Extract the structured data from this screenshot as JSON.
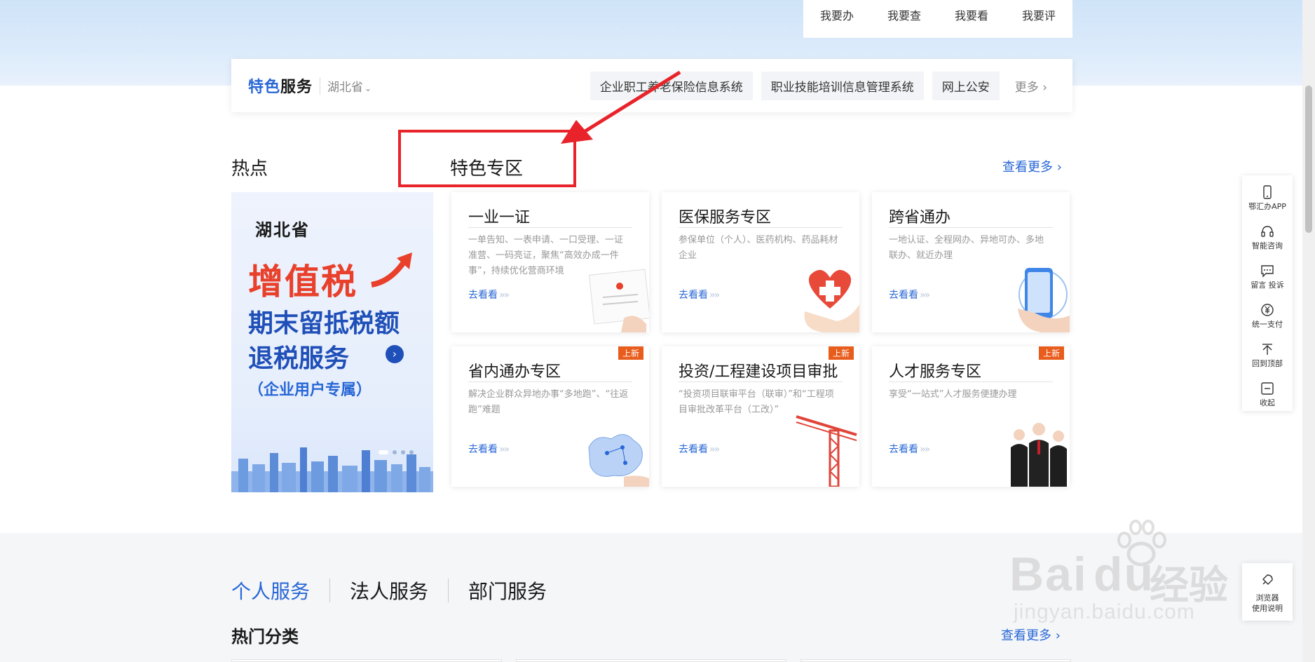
{
  "top_links": [
    "我要办",
    "我要查",
    "我要看",
    "我要评"
  ],
  "feature": {
    "title_part1": "特色",
    "title_part2": "服务",
    "region": "湖北省",
    "links": [
      "企业职工养老保险信息系统",
      "职业技能培训信息管理系统",
      "网上公安"
    ],
    "more": "更多 ›"
  },
  "section": {
    "hot": "热点",
    "special": "特色专区",
    "more": "查看更多 ›"
  },
  "promo": {
    "province": "湖北省",
    "tax": "增值税",
    "line1": "期末留抵税额",
    "line2": "退税服务",
    "line3": "（企业用户专属）"
  },
  "cards": [
    {
      "title": "一业一证",
      "desc": "一单告知、一表申请、一口受理、一证准营、一码亮证，聚焦“高效办成一件事”，持续优化营商环境",
      "go": "去看看",
      "new": ""
    },
    {
      "title": "医保服务专区",
      "desc": "参保单位（个人）、医药机构、药品耗材企业",
      "go": "去看看",
      "new": ""
    },
    {
      "title": "跨省通办",
      "desc": "一地认证、全程网办、异地可办、多地联办、就近办理",
      "go": "去看看",
      "new": ""
    },
    {
      "title": "省内通办专区",
      "desc": "解决企业群众异地办事“多地跑”、“往返跑”难题",
      "go": "去看看",
      "new": "上新"
    },
    {
      "title": "投资/工程建设项目审批",
      "desc": "“投资项目联审平台（联审）”和“工程项目审批改革平台（工改）”",
      "go": "去看看",
      "new": "上新"
    },
    {
      "title": "人才服务专区",
      "desc": "享受“一站式”人才服务便捷办理",
      "go": "去看看",
      "new": "上新"
    }
  ],
  "sidebar": [
    "鄂汇办APP",
    "智能咨询",
    "留言 投诉",
    "统一支付",
    "回到顶部",
    "收起"
  ],
  "sidebar2": {
    "line1": "浏览器",
    "line2": "使用说明"
  },
  "tabs": [
    "个人服务",
    "法人服务",
    "部门服务"
  ],
  "hot_category": "热门分类",
  "more2": "查看更多 ›",
  "watermark": {
    "brand": "Bai",
    "du": "du",
    "cn": "经验",
    "url": "jingyan.baidu.com"
  },
  "colors": {
    "accent": "#2867d6",
    "annotation": "#e8232a",
    "new_badge": "#e85c1c"
  }
}
